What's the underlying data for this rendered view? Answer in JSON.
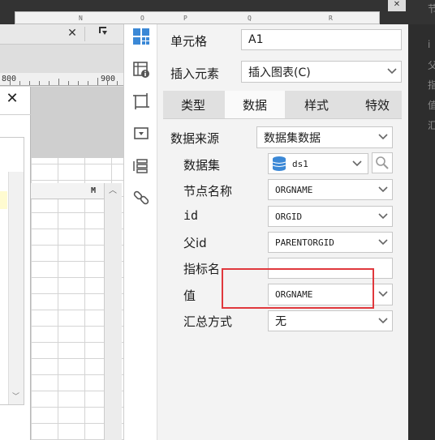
{
  "top": {
    "col_headers": [
      "N",
      "O",
      "P",
      "Q",
      "R"
    ],
    "close_symbol": "✕"
  },
  "left": {
    "tab_close": "✕",
    "tab_dropdown": "▼",
    "ruler_labels": [
      "800",
      "900"
    ],
    "dialog_close": "✕",
    "grid_column": "M",
    "scroll_up": "︿",
    "scroll_down": "﹀"
  },
  "icons": [
    "layout-icon",
    "cell-info-icon",
    "crop-icon",
    "dropdown-widget-icon",
    "stack-icon",
    "link-icon"
  ],
  "panel": {
    "cell_label": "单元格",
    "cell_value": "A1",
    "insert_label": "插入元素",
    "insert_value": "插入图表(C)",
    "tabs": [
      "类型",
      "数据",
      "样式",
      "特效"
    ],
    "active_tab": "数据",
    "data_source_label": "数据来源",
    "data_source_value": "数据集数据",
    "dataset_label": "数据集",
    "dataset_value": "ds1",
    "node_name_label": "节点名称",
    "node_name_value": "ORGNAME",
    "id_label": "id",
    "id_value": "ORGID",
    "parent_id_label": "父id",
    "parent_id_value": "PARENTORGID",
    "indicator_label": "指标名",
    "indicator_value": "",
    "value_label": "值",
    "value_value": "ORGNAME",
    "summary_label": "汇总方式",
    "summary_value": "无"
  },
  "background_right": [
    "节",
    "i",
    "父",
    "指",
    "值",
    "汇"
  ],
  "colors": {
    "accent_blue": "#3b88d6",
    "highlight_red": "#e0383d",
    "panel_bg": "#f3f3f3"
  }
}
